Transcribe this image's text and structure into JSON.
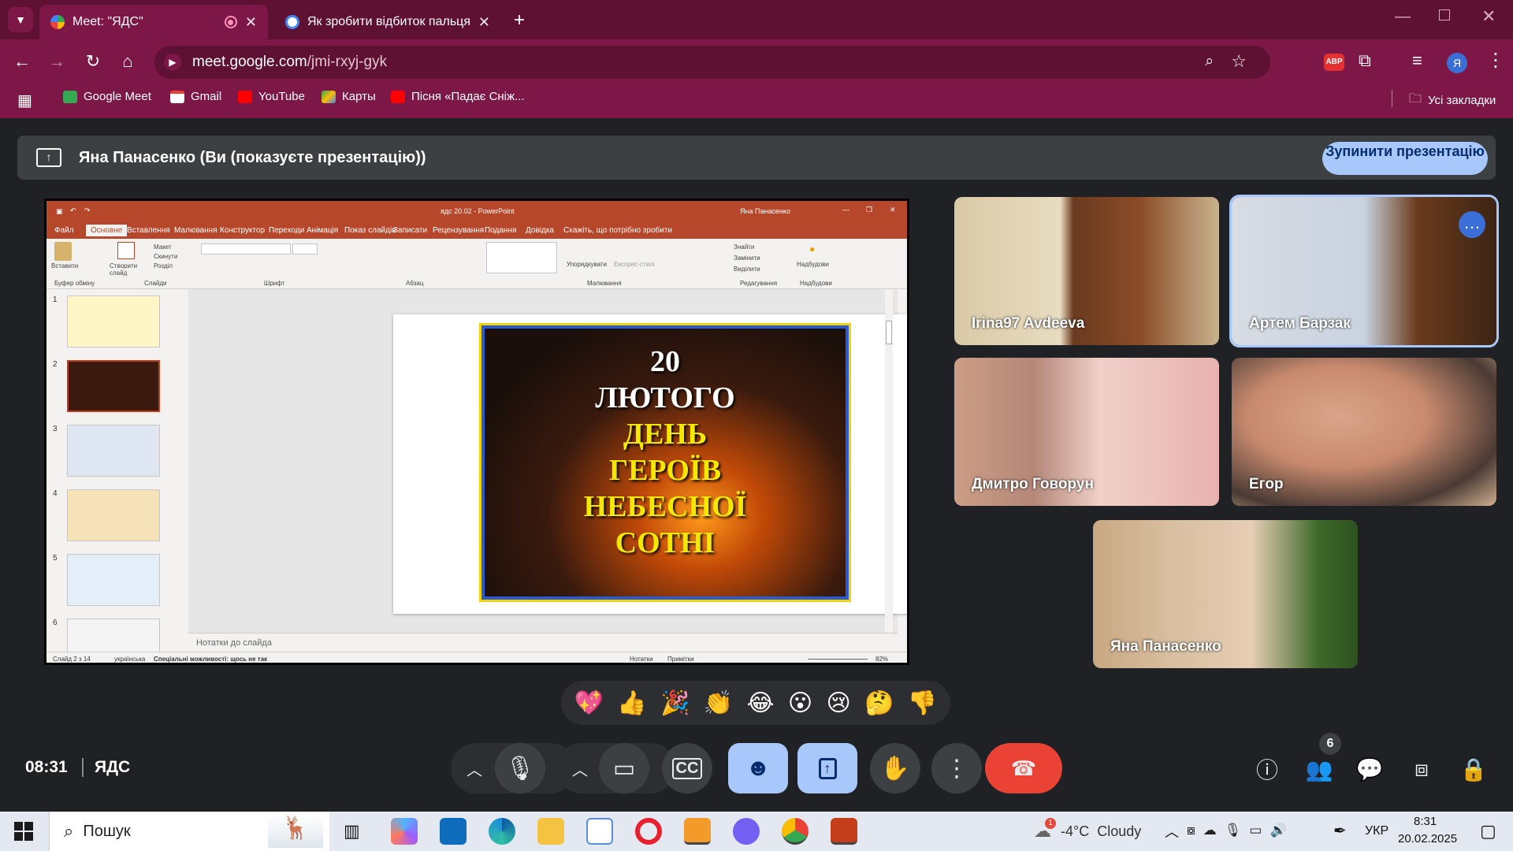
{
  "browser": {
    "tabs": [
      {
        "title": "Meet: \"ЯДС\"",
        "active": true
      },
      {
        "title": "Як зробити відбиток пальця в",
        "active": false
      }
    ],
    "url_host": "meet.google.com",
    "url_path": "/jmi-rxyj-gyk",
    "profile_initial": "Я",
    "adblock_label": "ABP",
    "bookmarks": [
      "Google Meet",
      "Gmail",
      "YouTube",
      "Карты",
      "Пісня «Падає Сніж..."
    ],
    "all_bookmarks": "Усі закладки"
  },
  "meet": {
    "presenting_text": "Яна Панасенко (Ви (показуєте презентацію))",
    "stop_button": "Зупинити презентацію",
    "participants": [
      "Irina97 Avdeeva",
      "Артем Барзак",
      "Дмитро Говорун",
      "Егор",
      "Яна Панасенко"
    ],
    "reactions": [
      "💖",
      "👍",
      "🎉",
      "👏",
      "😂",
      "😮",
      "😢",
      "🤔",
      "👎"
    ],
    "time": "08:31",
    "meeting_name": "ЯДС",
    "people_count": "6",
    "colors": {
      "accent": "#a8c7fa",
      "end_call": "#ea4335",
      "surface": "#3c4043"
    }
  },
  "ppt": {
    "title": "ядс 20.02 - PowerPoint",
    "user": "Яна Панасенко",
    "tabs": [
      "Файл",
      "Основне",
      "Вставлення",
      "Малювання",
      "Конструктор",
      "Переходи",
      "Анімація",
      "Показ слайдів",
      "Записати",
      "Рецензування",
      "Подання",
      "Довідка",
      "Скажіть, що потрібно зробити"
    ],
    "ribbon_groups": [
      "Буфер обміну",
      "Слайди",
      "Шрифт",
      "Абзац",
      "Малювання",
      "Редагування",
      "Надбудови"
    ],
    "ribbon_buttons": [
      "Вставити",
      "Створити слайд",
      "Макет",
      "Скинути",
      "Розділ",
      "Упорядкувати",
      "Експрес-стилі",
      "Знайти",
      "Замінити",
      "Виділити",
      "Надбудови"
    ],
    "slide_numbers": [
      "1",
      "2",
      "3",
      "4",
      "5",
      "6"
    ],
    "slide_lines": [
      "20",
      "ЛЮТОГО",
      "ДЕНЬ",
      "ГЕРОЇВ",
      "НЕБЕСНОЇ",
      "СОТНІ"
    ],
    "notes_placeholder": "Нотатки до слайда",
    "status_slide": "Слайд 2 з 14",
    "status_lang": "українська",
    "status_accessibility": "Спеціальні можливості: щось не так",
    "status_notes": "Нотатки",
    "status_comments": "Примітки",
    "zoom": "82%"
  },
  "taskbar": {
    "search": "Пошук",
    "weather": "-4°C  Cloudy",
    "weather_badge": "1",
    "lang": "УКР",
    "time": "8:31",
    "date": "20.02.2025"
  }
}
